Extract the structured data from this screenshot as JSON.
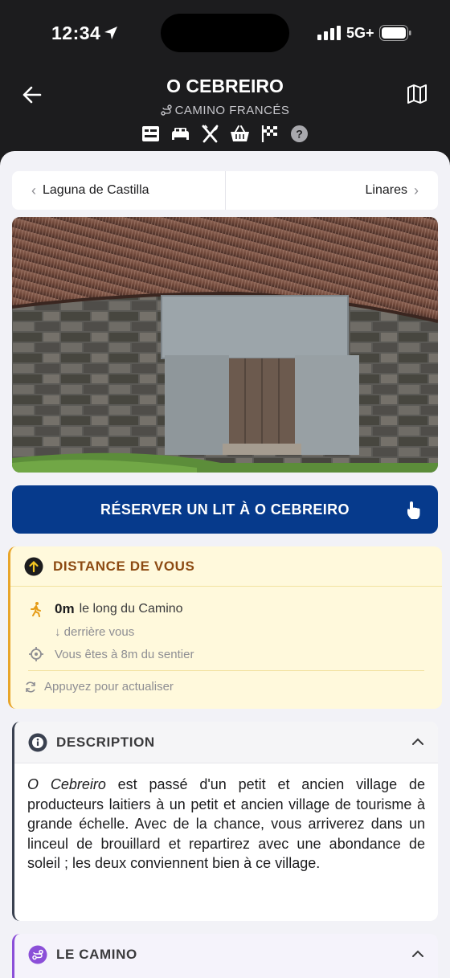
{
  "status": {
    "time": "12:34",
    "network": "5G+"
  },
  "header": {
    "title": "O CEBREIRO",
    "subtitle": "CAMINO FRANCÉS",
    "amenities": [
      "albergue-icon",
      "bed-icon",
      "restaurant-icon",
      "shop-icon",
      "finish-flag-icon",
      "help-icon"
    ]
  },
  "nav": {
    "prev": "Laguna de Castilla",
    "next": "Linares"
  },
  "booking": {
    "label": "RÉSERVER UN LIT À O CEBREIRO"
  },
  "distance": {
    "title": "DISTANCE DE VOUS",
    "value": "0m",
    "along": "le long du Camino",
    "behind": "↓ derrière vous",
    "off_trail": "Vous êtes à 8m du sentier",
    "refresh": "Appuyez pour actualiser"
  },
  "description": {
    "title": "DESCRIPTION",
    "place": "O Cebreiro",
    "text": " est passé d'un petit et ancien village de producteurs laitiers à un petit et ancien village de tourisme à grande échelle. Avec de la chance, vous arriverez dans un linceul de brouillard et repartirez avec une abondance de soleil ; les deux conviennent bien à ce village."
  },
  "camino_section": {
    "title": "LE CAMINO"
  },
  "colors": {
    "header_bg": "#1c1c1e",
    "book_button": "#063a8c",
    "distance_accent": "#e8a52a",
    "camino_accent": "#8b4fd8"
  }
}
